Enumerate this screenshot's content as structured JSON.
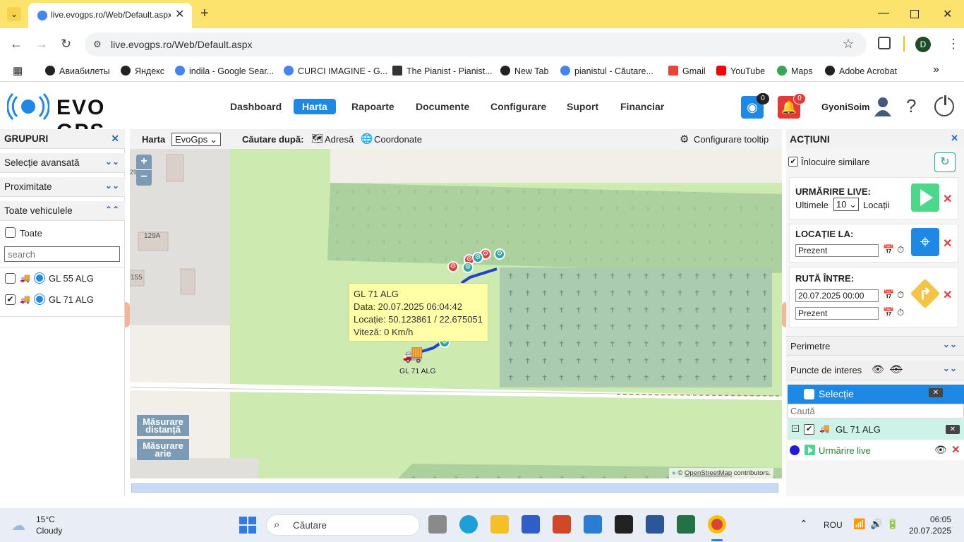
{
  "browser": {
    "tab_title": "live.evogps.ro/Web/Default.aspx",
    "url": "live.evogps.ro/Web/Default.aspx",
    "profile_initial": "D"
  },
  "bookmarks": [
    "Авиабилеты",
    "Яндекс",
    "indila - Google Sear...",
    "CURCI IMAGINE - G...",
    "The Pianist - Pianist...",
    "New Tab",
    "pianistul - Căutare...",
    "Gmail",
    "YouTube",
    "Maps",
    "Adobe Acrobat"
  ],
  "app": {
    "logo": "EVO GPS",
    "nav": [
      "Dashboard",
      "Harta",
      "Rapoarte",
      "Documente",
      "Configurare",
      "Suport",
      "Financiar"
    ],
    "active_nav": "Harta",
    "feed_count": "0",
    "alert_count": "0",
    "user": "GyoniSoim"
  },
  "left": {
    "title": "GRUPURI",
    "sections": [
      "Selecție avansată",
      "Proximitate",
      "Toate vehiculele"
    ],
    "all_label": "Toate",
    "search_placeholder": "search",
    "vehicles": [
      {
        "name": "GL 55 ALG",
        "checked": false
      },
      {
        "name": "GL 71 ALG",
        "checked": true
      }
    ]
  },
  "maptop": {
    "harta_label": "Harta",
    "map_select": "EvoGps",
    "search_by": "Căutare după:",
    "address": "Adresă",
    "coords": "Coordonate",
    "tooltip_cfg": "Configurare tooltip"
  },
  "map": {
    "zoom_in": "+",
    "zoom_out": "−",
    "labels": [
      "129A",
      "155",
      "29"
    ],
    "tooltip": {
      "title": "GL 71 ALG",
      "date": "Data: 20.07.2025 06:04:42",
      "location": "Locație: 50.123861 / 22.675051",
      "speed": "Viteză: 0 Km/h"
    },
    "vehicle_label": "GL 71 ALG",
    "measure_dist": "Măsurare distanță",
    "measure_area": "Măsurare arie",
    "attribution_prefix": "©",
    "attribution_link": "OpenStreetMap",
    "attribution_suffix": "contributors."
  },
  "right": {
    "title": "ACȚIUNI",
    "replace_similar": "Înlocuire similare",
    "live_title": "URMĂRIRE LIVE:",
    "live_last": "Ultimele",
    "live_count": "10",
    "live_loc": "Locații",
    "loc_title": "LOCAȚIE LA:",
    "loc_value": "Prezent",
    "route_title": "RUTĂ ÎNTRE:",
    "route_from": "20.07.2025 00:00",
    "route_to": "Prezent",
    "perimeters": "Perimetre",
    "poi": "Puncte de interes",
    "selection": "Selecție",
    "search_placeholder": "Caută",
    "item_vehicle": "GL 71 ALG",
    "item_live": "Urmărire live"
  },
  "taskbar": {
    "temp": "15°C",
    "weather": "Cloudy",
    "search": "Căutare",
    "lang": "ROU",
    "time": "06:05",
    "date": "20.07.2025"
  }
}
